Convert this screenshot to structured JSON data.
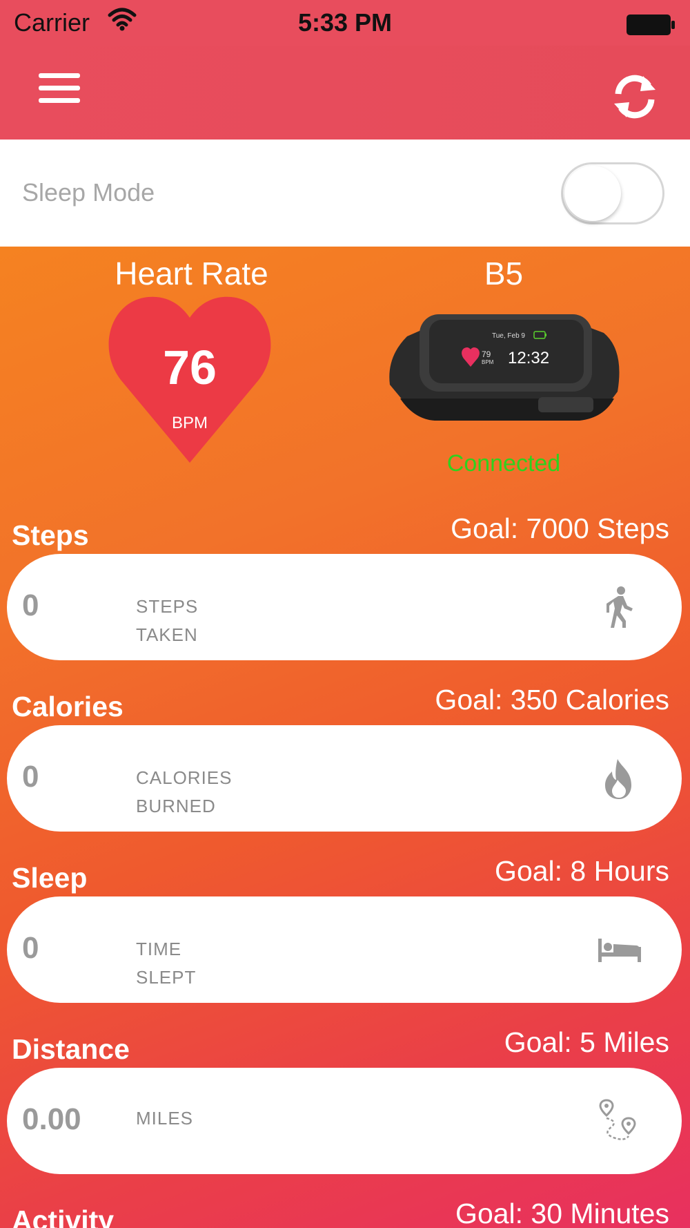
{
  "status_bar": {
    "carrier": "Carrier",
    "time": "5:33 PM"
  },
  "nav": {
    "menu_icon": "hamburger-menu-icon",
    "sync_icon": "sync-icon"
  },
  "sleep_mode": {
    "label": "Sleep Mode",
    "enabled": false
  },
  "heart_rate": {
    "title": "Heart Rate",
    "value": "76",
    "unit": "BPM",
    "color": "#ec3a45"
  },
  "device": {
    "name": "B5",
    "status": "Connected",
    "status_color": "#2fd11e",
    "screen_date": "Tue, Feb 9",
    "screen_bpm": "79",
    "screen_bpm_unit": "BPM",
    "screen_time": "12:32"
  },
  "stats": [
    {
      "title": "Steps",
      "goal": "Goal: 7000 Steps",
      "value": "0",
      "label_line1": "STEPS",
      "label_line2": "TAKEN",
      "icon": "walking-icon"
    },
    {
      "title": "Calories",
      "goal": "Goal: 350 Calories",
      "value": "0",
      "label_line1": "CALORIES",
      "label_line2": "BURNED",
      "icon": "flame-icon"
    },
    {
      "title": "Sleep",
      "goal": "Goal: 8 Hours",
      "value": "0",
      "label_line1": "TIME",
      "label_line2": "SLEPT",
      "icon": "bed-icon"
    },
    {
      "title": "Distance",
      "goal": "Goal: 5 Miles",
      "value": "0.00",
      "label_line1": "MILES",
      "label_line2": "",
      "icon": "route-icon"
    },
    {
      "title": "Activity",
      "goal": "Goal: 30 Minutes"
    }
  ]
}
